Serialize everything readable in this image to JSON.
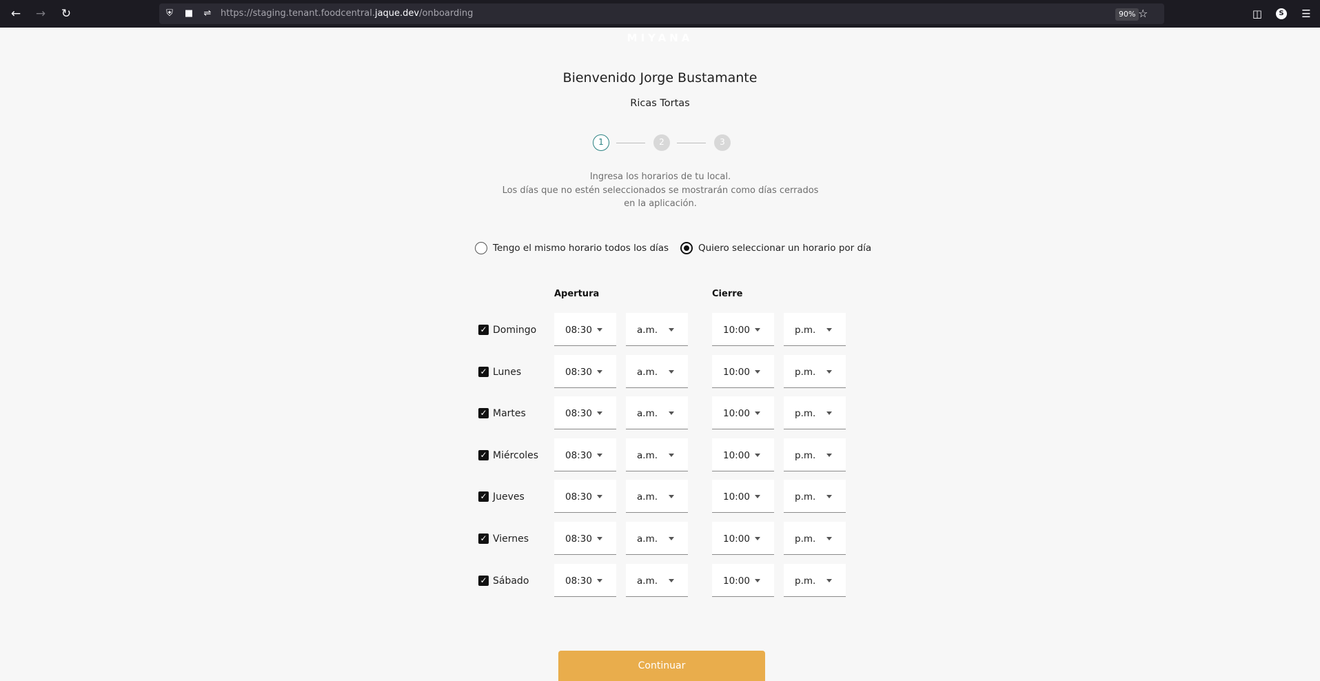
{
  "browser": {
    "url_prefix": "https://staging.tenant.foodcentral.",
    "url_host": "jaque.dev",
    "url_path": "/onboarding",
    "zoom": "90%",
    "avatar_letter": "S"
  },
  "header": {
    "logo_text": "MIYANA",
    "title": "Bienvenido Jorge Bustamante",
    "subtitle": "Ricas Tortas"
  },
  "stepper": {
    "steps": [
      "1",
      "2",
      "3"
    ],
    "active_step": 1
  },
  "instructions": {
    "line1": "Ingresa los horarios de tu local.",
    "line2": "Los días que no estén seleccionados se mostrarán como días cerrados en la aplicación."
  },
  "schedule_mode": {
    "option_same": "Tengo el mismo horario todos los días",
    "option_per_day": "Quiero seleccionar un horario por día",
    "selected": "per_day"
  },
  "columns": {
    "opening": "Apertura",
    "closing": "Cierre"
  },
  "days": [
    {
      "name": "Domingo",
      "checked": true,
      "open_time": "08:30",
      "open_period": "a.m.",
      "close_time": "10:00",
      "close_period": "p.m."
    },
    {
      "name": "Lunes",
      "checked": true,
      "open_time": "08:30",
      "open_period": "a.m.",
      "close_time": "10:00",
      "close_period": "p.m."
    },
    {
      "name": "Martes",
      "checked": true,
      "open_time": "08:30",
      "open_period": "a.m.",
      "close_time": "10:00",
      "close_period": "p.m."
    },
    {
      "name": "Miércoles",
      "checked": true,
      "open_time": "08:30",
      "open_period": "a.m.",
      "close_time": "10:00",
      "close_period": "p.m."
    },
    {
      "name": "Jueves",
      "checked": true,
      "open_time": "08:30",
      "open_period": "a.m.",
      "close_time": "10:00",
      "close_period": "p.m."
    },
    {
      "name": "Viernes",
      "checked": true,
      "open_time": "08:30",
      "open_period": "a.m.",
      "close_time": "10:00",
      "close_period": "p.m."
    },
    {
      "name": "Sábado",
      "checked": true,
      "open_time": "08:30",
      "open_period": "a.m.",
      "close_time": "10:00",
      "close_period": "p.m."
    }
  ],
  "actions": {
    "continue_label": "Continuar"
  },
  "colors": {
    "accent": "#e9ad4c",
    "step_active": "#2b8282"
  }
}
